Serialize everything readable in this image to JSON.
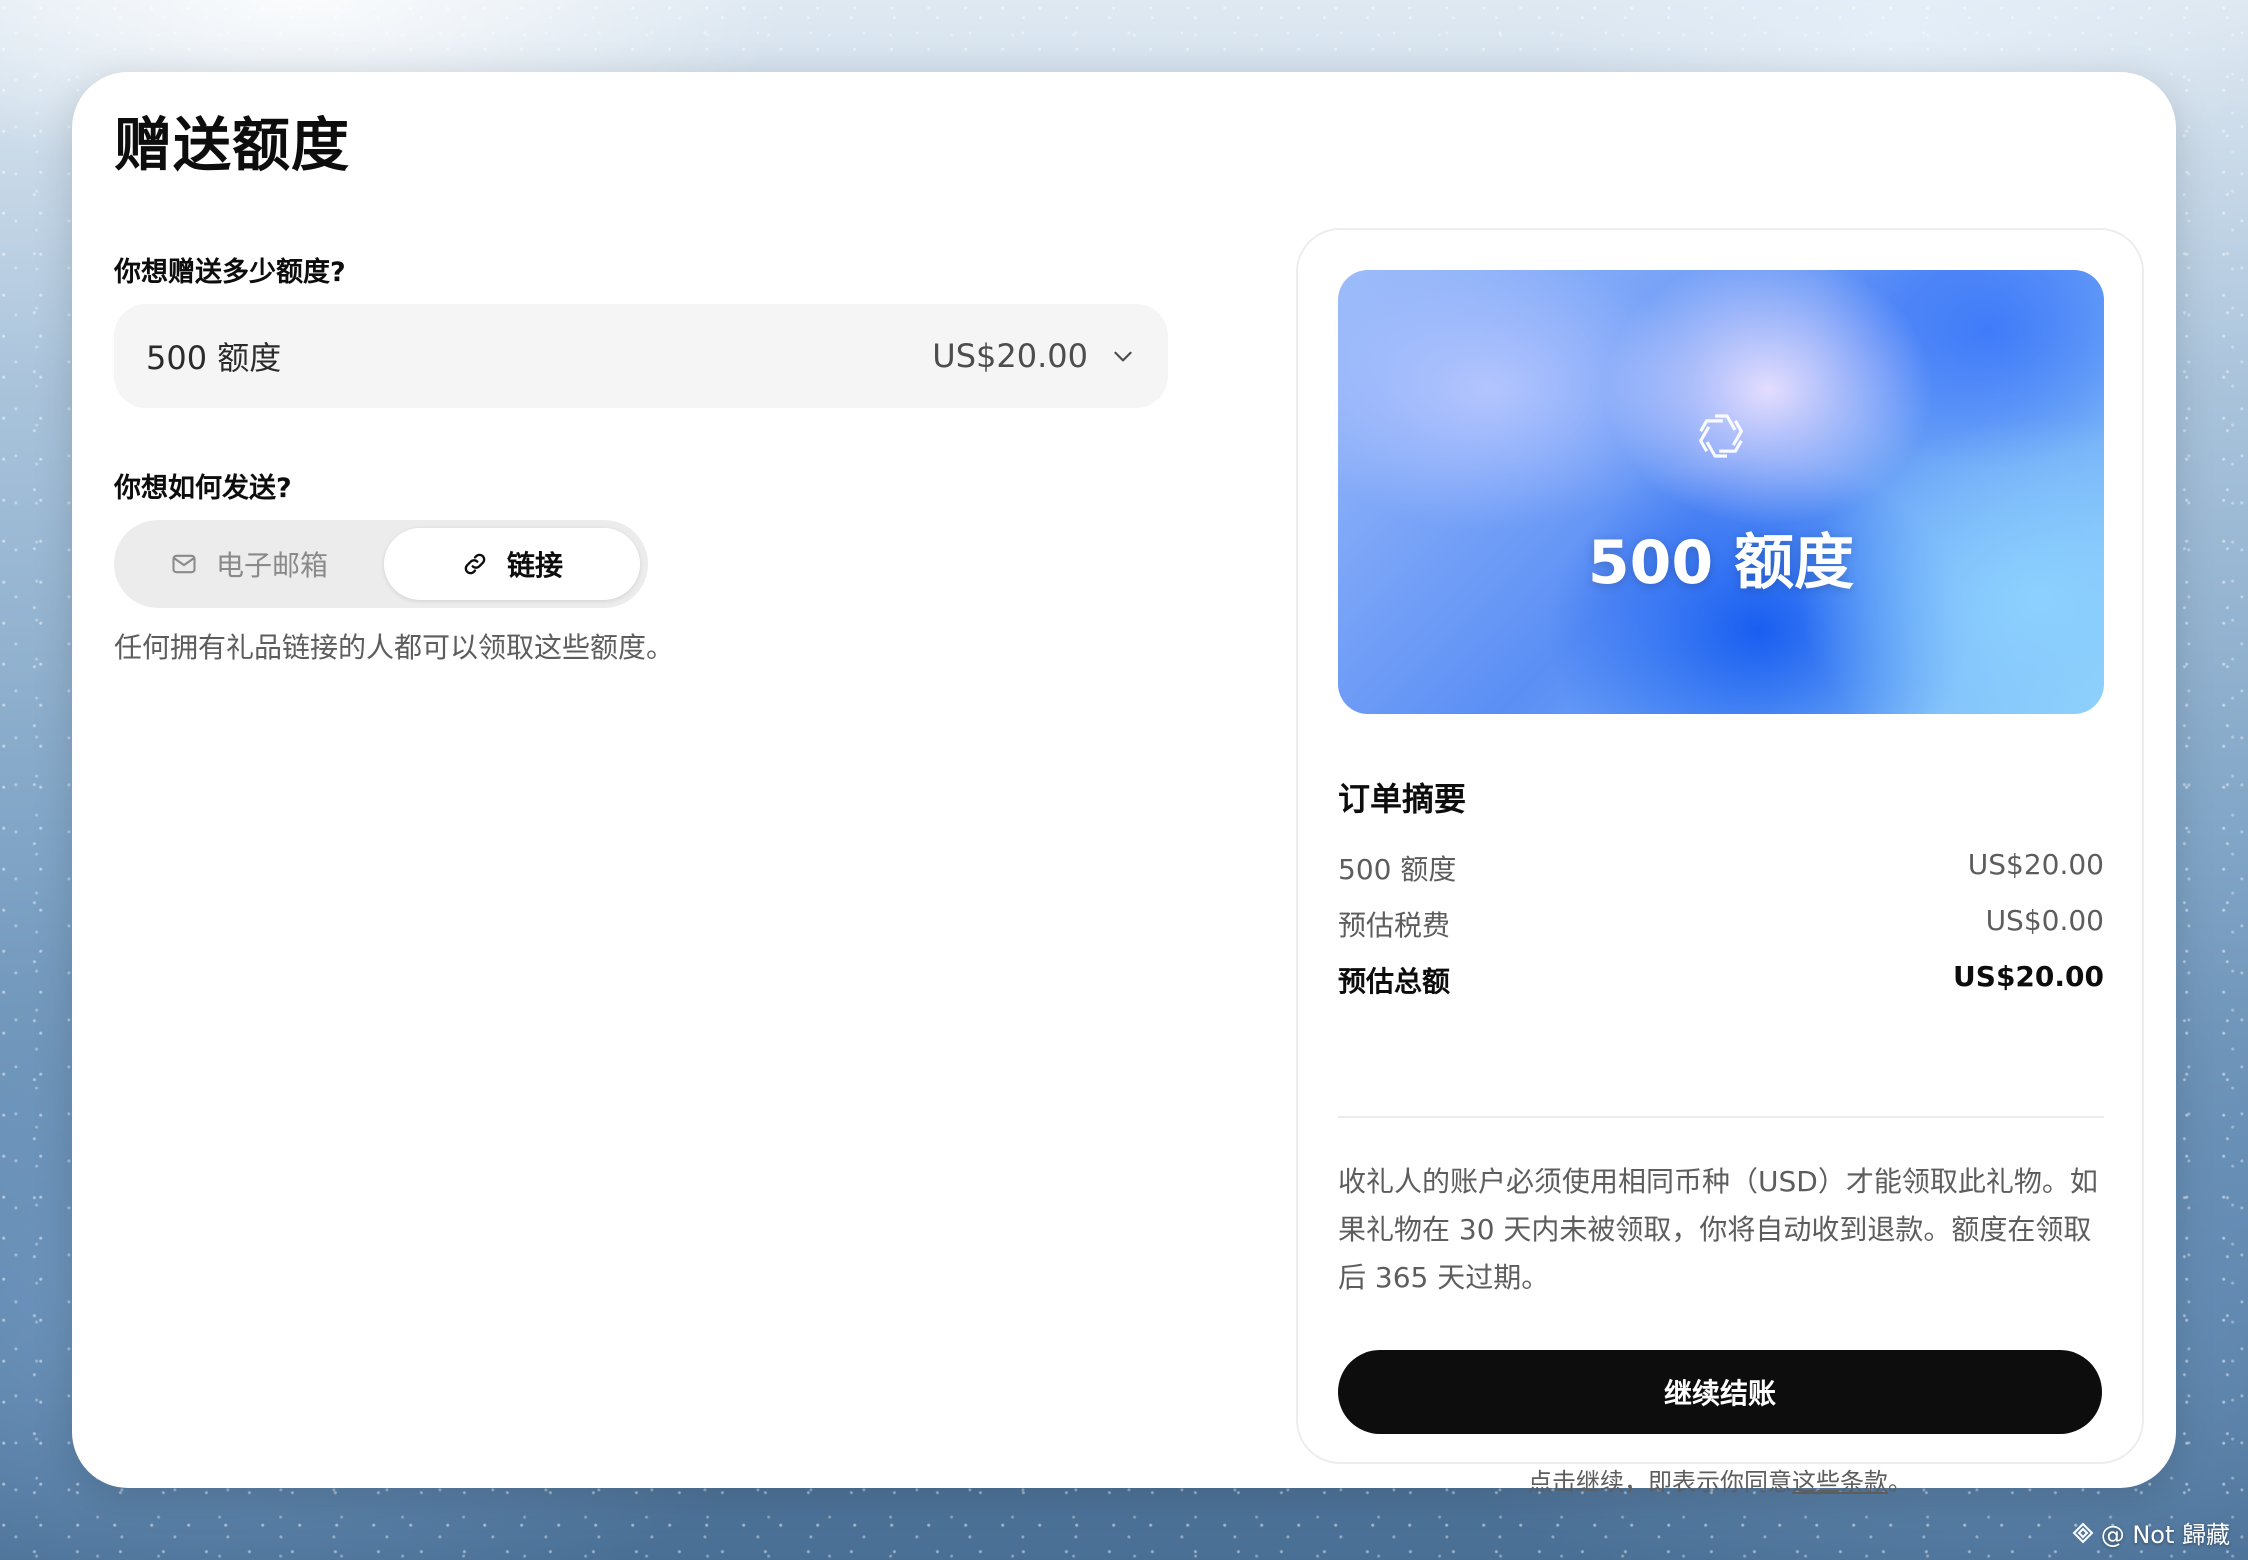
{
  "title": "赠送额度",
  "amount_section": {
    "label": "你想赠送多少额度?",
    "selected_amount": "500 额度",
    "selected_price": "US$20.00"
  },
  "delivery_section": {
    "label": "你想如何发送?",
    "options": [
      {
        "label": "电子邮箱",
        "icon": "mail-icon",
        "selected": false
      },
      {
        "label": "链接",
        "icon": "link-icon",
        "selected": true
      }
    ],
    "helper": "任何拥有礼品链接的人都可以领取这些额度。"
  },
  "gift_card": {
    "amount": "500 额度",
    "colors": {
      "start": "#9dbcfa",
      "mid": "#1a5cf0",
      "end": "#8fd0fa"
    }
  },
  "order_summary": {
    "title": "订单摘要",
    "rows": [
      {
        "label": "500 额度",
        "value": "US$20.00"
      },
      {
        "label": "预估税费",
        "value": "US$0.00"
      },
      {
        "label": "预估总额",
        "value": "US$20.00"
      }
    ],
    "notice": "收礼人的账户必须使用相同币种（USD）才能领取此礼物。如果礼物在 30 天内未被领取，你将自动收到退款。额度在领取后 365 天过期。",
    "checkout_label": "继续结账",
    "terms_prefix": "点击继续，即表示你同意",
    "terms_link": "这些条款",
    "terms_suffix": "。"
  },
  "watermark": "@ Not 歸藏"
}
